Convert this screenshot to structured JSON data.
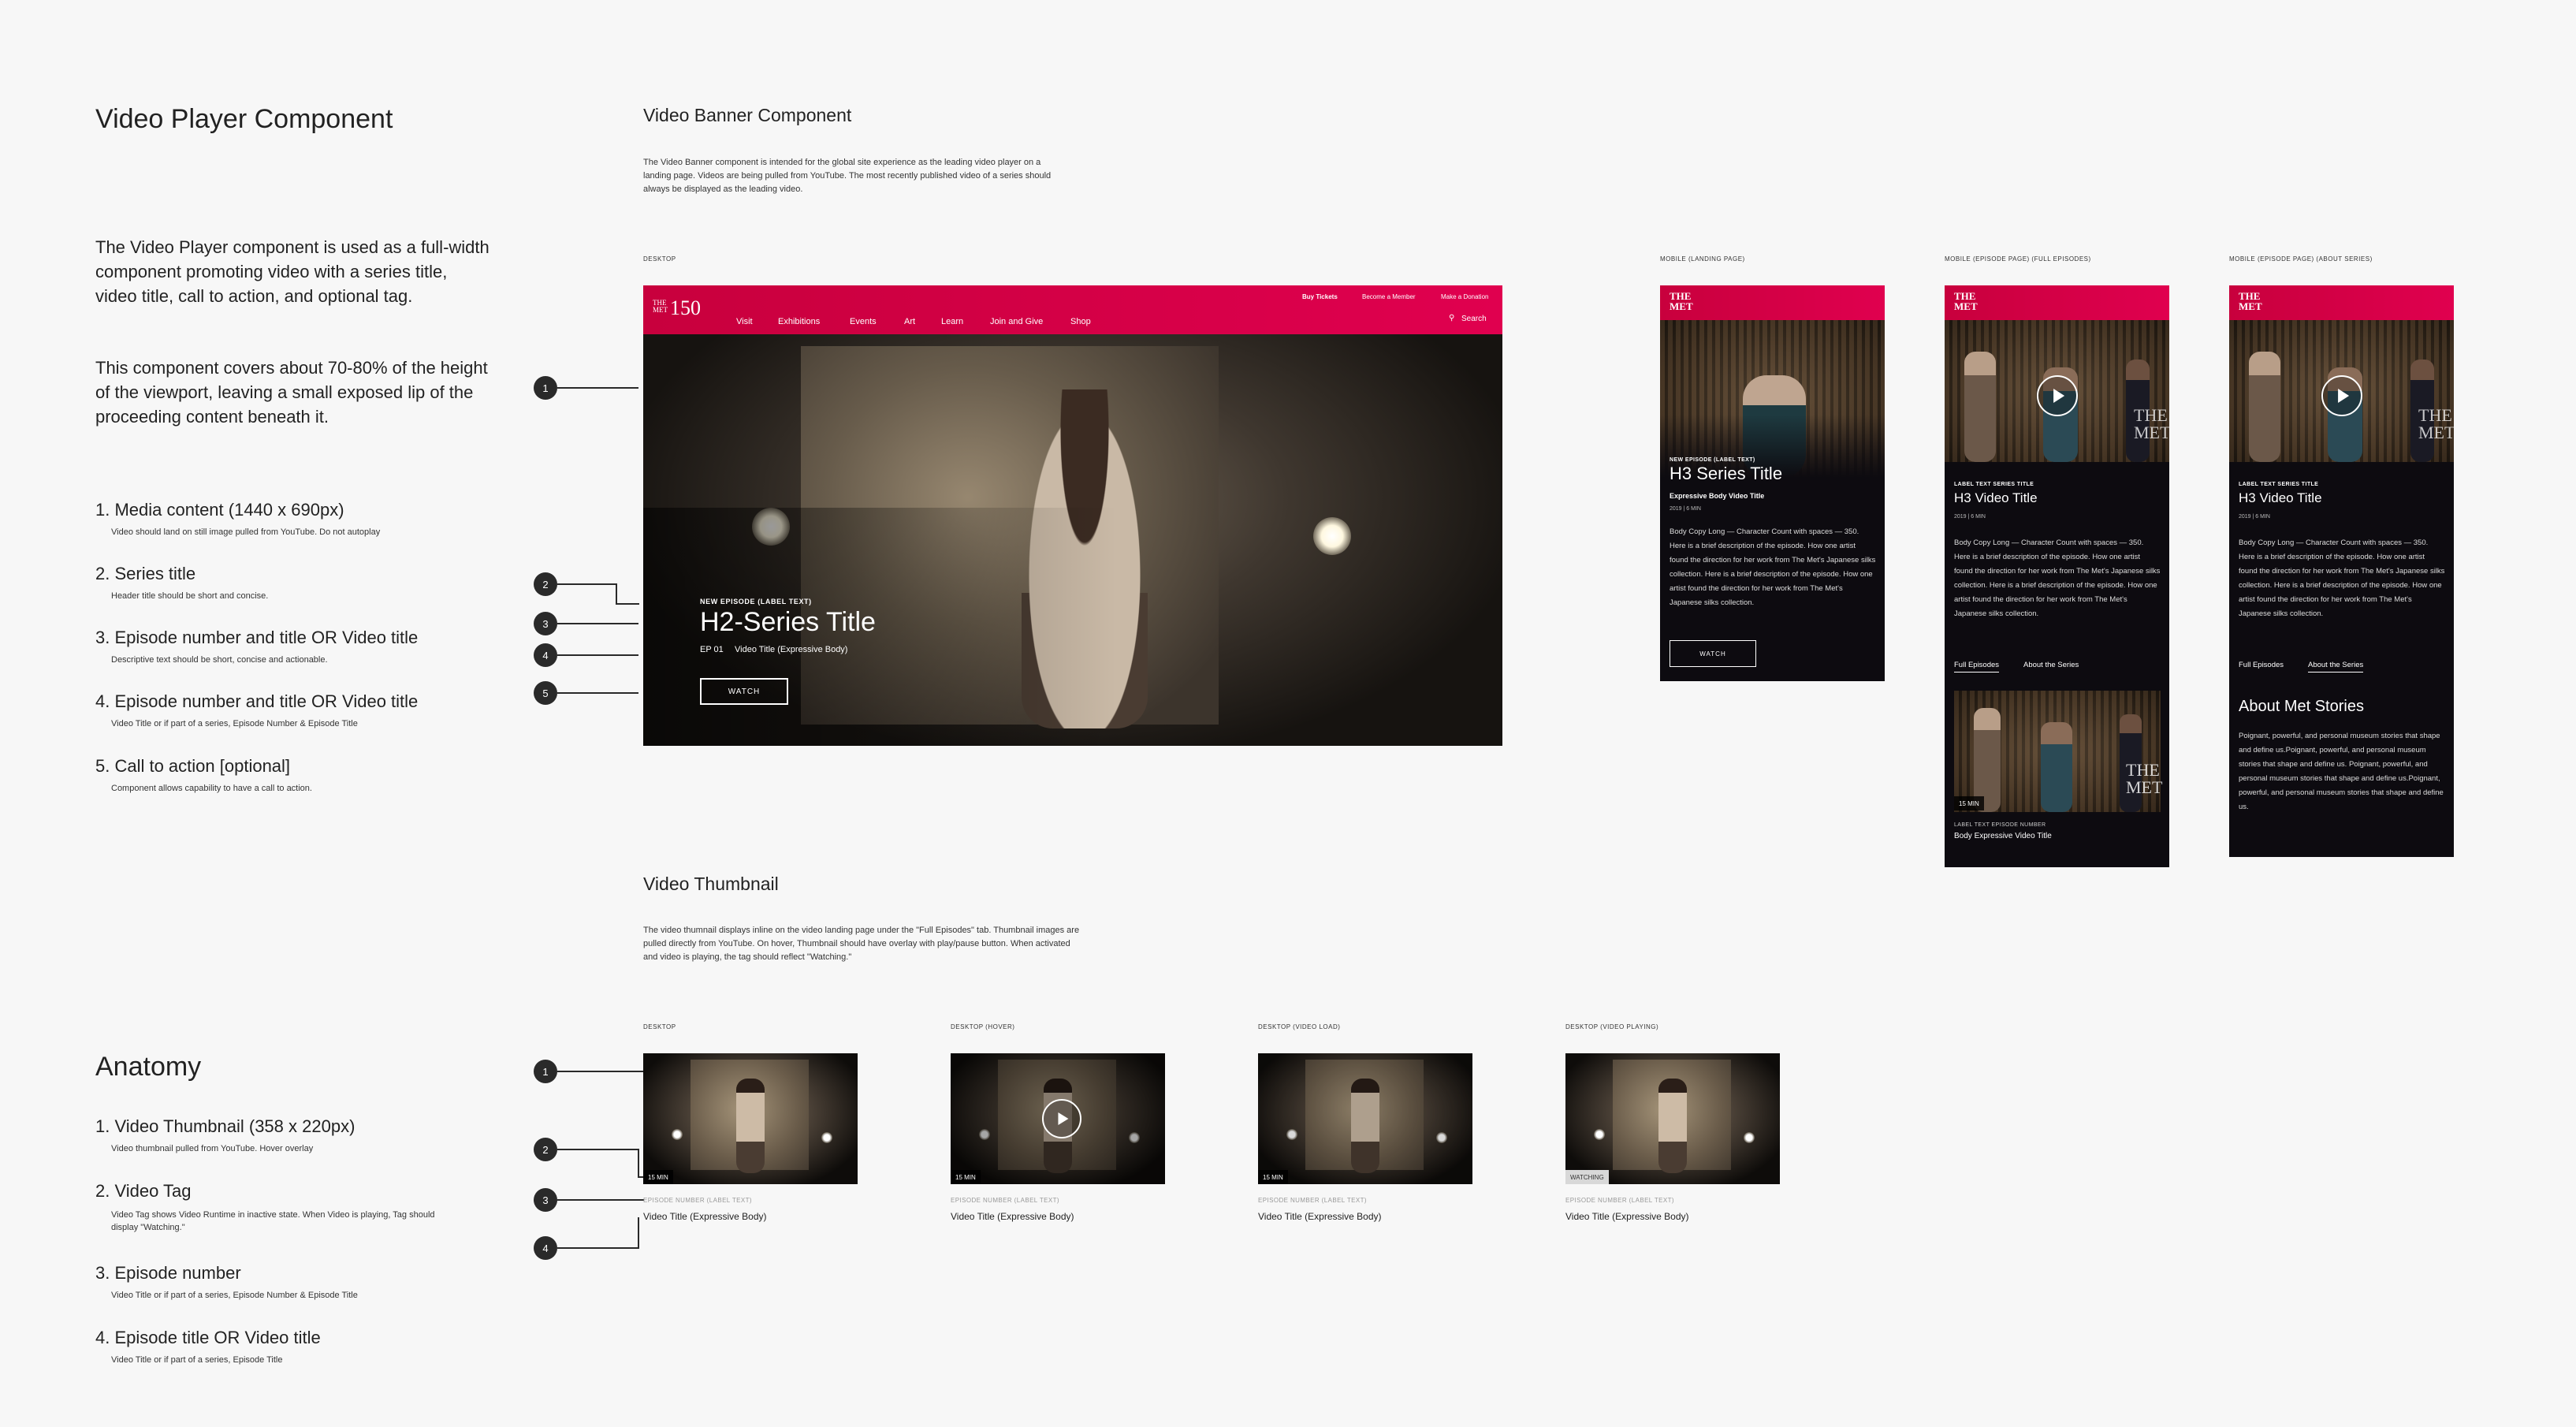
{
  "left": {
    "title": "Video Player Component",
    "intro1": "The Video Player component is used as a full-width component promoting video with a series title, video title, call to action, and optional tag.",
    "intro2": "This component covers about 70-80% of the height of the viewport, leaving a small exposed lip of the proceeding content beneath it.",
    "list": [
      {
        "title": "1. Media content (1440 x 690px)",
        "desc": "Video should land on still image pulled from YouTube. Do not autoplay"
      },
      {
        "title": "2. Series title",
        "desc": "Header title should be short and concise."
      },
      {
        "title": "3. Episode number and title OR Video title",
        "desc": "Descriptive text should be short, concise and actionable."
      },
      {
        "title": "4. Episode number and title OR Video title",
        "desc": "Video Title or if part of a series, Episode Number & Episode Title"
      },
      {
        "title": "5. Call to action [optional]",
        "desc": "Component allows capability to have a call to action."
      }
    ],
    "anatomy_title": "Anatomy",
    "anatomy": [
      {
        "title": "1. Video Thumbnail (358 x 220px)",
        "desc": "Video thumbnail pulled from YouTube. Hover overlay"
      },
      {
        "title": "2. Video Tag",
        "desc": "Video Tag shows Video Runtime in inactive state. When Video is playing, Tag should display \"Watching.\""
      },
      {
        "title": "3. Episode number",
        "desc": "Video Title or if part of a series, Episode Number & Episode Title"
      },
      {
        "title": "4. Episode title OR Video title",
        "desc": "Video Title or if part of a series, Episode Title"
      }
    ]
  },
  "banner": {
    "heading": "Video Banner Component",
    "desc": "The Video Banner component is intended for the global site experience as the leading video player on a landing page. Videos are being pulled from YouTube. The most recently published video of a series should always be displayed as the leading video.",
    "desktop_label": "DESKTOP",
    "logo_small": "THE MET",
    "logo_num": "150",
    "nav": [
      "Visit",
      "Exhibitions",
      "Events",
      "Art",
      "Learn",
      "Join and Give",
      "Shop"
    ],
    "util": [
      "Buy Tickets",
      "Become a Member",
      "Make a Donation"
    ],
    "search": "Search",
    "eyebrow": "NEW EPISODE (LABEL TEXT)",
    "series_title": "H2-Series Title",
    "episode": "EP 01",
    "video_title": "Video Title (Expressive Body)",
    "cta": "WATCH",
    "markers": [
      "1",
      "2",
      "3",
      "4",
      "5"
    ]
  },
  "mobile": [
    {
      "label": "MOBILE (LANDING PAGE)",
      "logo": "THE MET",
      "eyebrow": "NEW EPISODE (LABEL TEXT)",
      "title": "H3 Series Title",
      "subtitle": "Expressive Body Video Title",
      "meta": "2019 | 6 MIN",
      "body": "Body Copy Long — Character Count with spaces — 350. Here is a brief description of the episode. How one artist found the direction for her work from The Met's Japanese silks collection. Here is a brief description of the episode. How one artist found the direction for her work from The Met's Japanese silks collection.",
      "cta": "WATCH"
    },
    {
      "label": "MOBILE (EPISODE PAGE) (FULL EPISODES)",
      "logo": "THE MET",
      "eyebrow": "LABEL TEXT SERIES TITLE",
      "title": "H3 Video Title",
      "meta": "2019 | 6 MIN",
      "body": "Body Copy Long — Character Count with spaces — 350. Here is a brief description of the episode. How one artist found the direction for her work from The Met's Japanese silks collection. Here is a brief description of the episode. How one artist found the direction for her work from The Met's Japanese silks collection.",
      "tabs": [
        "Full Episodes",
        "About the Series"
      ],
      "watermark": "THE MET",
      "thumb_tag": "15 MIN",
      "thumb_eyebrow": "LABEL TEXT EPISODE NUMBER",
      "thumb_title": "Body Expressive Video Title"
    },
    {
      "label": "MOBILE (EPISODE PAGE) (ABOUT SERIES)",
      "logo": "THE MET",
      "eyebrow": "LABEL TEXT SERIES TITLE",
      "title": "H3 Video Title",
      "meta": "2019 | 6 MIN",
      "body": "Body Copy Long — Character Count with spaces — 350. Here is a brief description of the episode. How one artist found the direction for her work from The Met's Japanese silks collection. Here is a brief description of the episode. How one artist found the direction for her work from The Met's Japanese silks collection.",
      "tabs": [
        "Full Episodes",
        "About the Series"
      ],
      "watermark": "THE MET",
      "about_title": "About Met Stories",
      "about_body": "Poignant, powerful, and personal museum stories that shape and define us.Poignant, powerful, and personal museum stories that shape and define us. Poignant, powerful, and personal museum stories that shape and define us.Poignant, powerful, and personal museum stories that shape and define us."
    }
  ],
  "thumbs": {
    "heading": "Video Thumbnail",
    "desc": "The video thumnail displays inline on the video landing page under the \"Full Episodes\" tab. Thumbnail images are pulled directly from YouTube. On hover, Thumbnail should have overlay with play/pause button. When activated and video is playing, the tag should reflect \"Watching.\"",
    "items": [
      {
        "label": "DESKTOP",
        "tag": "15 MIN",
        "eyebrow": "EPISODE NUMBER (LABEL TEXT)",
        "title": "Video Title (Expressive Body)"
      },
      {
        "label": "DESKTOP (HOVER)",
        "tag": "15 MIN",
        "eyebrow": "EPISODE NUMBER (LABEL TEXT)",
        "title": "Video Title (Expressive Body)"
      },
      {
        "label": "DESKTOP (VIDEO LOAD)",
        "tag": "15 MIN",
        "eyebrow": "EPISODE NUMBER (LABEL TEXT)",
        "title": "Video Title (Expressive Body)"
      },
      {
        "label": "DESKTOP (VIDEO PLAYING)",
        "tag": "WATCHING",
        "eyebrow": "EPISODE NUMBER (LABEL TEXT)",
        "title": "Video Title (Expressive Body)"
      }
    ],
    "markers": [
      "1",
      "2",
      "3",
      "4"
    ]
  }
}
